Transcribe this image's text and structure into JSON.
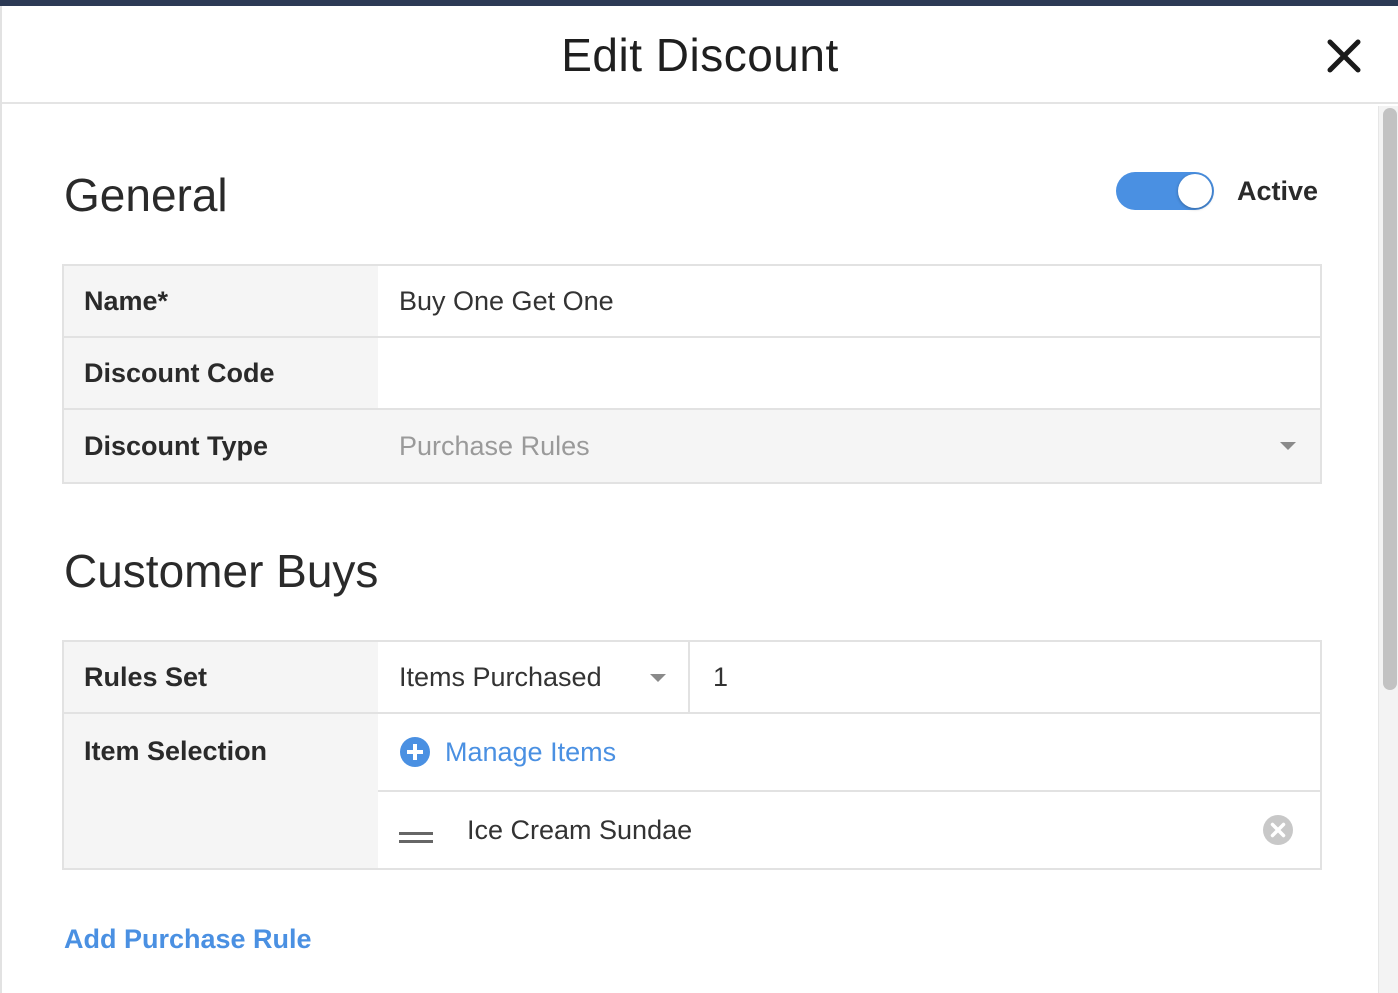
{
  "dialog": {
    "title": "Edit Discount",
    "close_icon": "close-icon"
  },
  "general": {
    "heading": "General",
    "active_label": "Active",
    "active": true,
    "fields": {
      "name_label": "Name*",
      "name_value": "Buy One Get One",
      "code_label": "Discount Code",
      "code_value": "",
      "type_label": "Discount Type",
      "type_value": "Purchase Rules"
    }
  },
  "customer_buys": {
    "heading": "Customer Buys",
    "rules_set_label": "Rules Set",
    "rules_set_value": "Items Purchased",
    "quantity_value": "1",
    "item_selection_label": "Item Selection",
    "manage_items_label": "Manage Items",
    "items": [
      {
        "name": "Ice Cream Sundae"
      }
    ],
    "add_rule_label": "Add Purchase Rule"
  },
  "colors": {
    "accent": "#4a90e2",
    "header_bar": "#2c3a55"
  }
}
